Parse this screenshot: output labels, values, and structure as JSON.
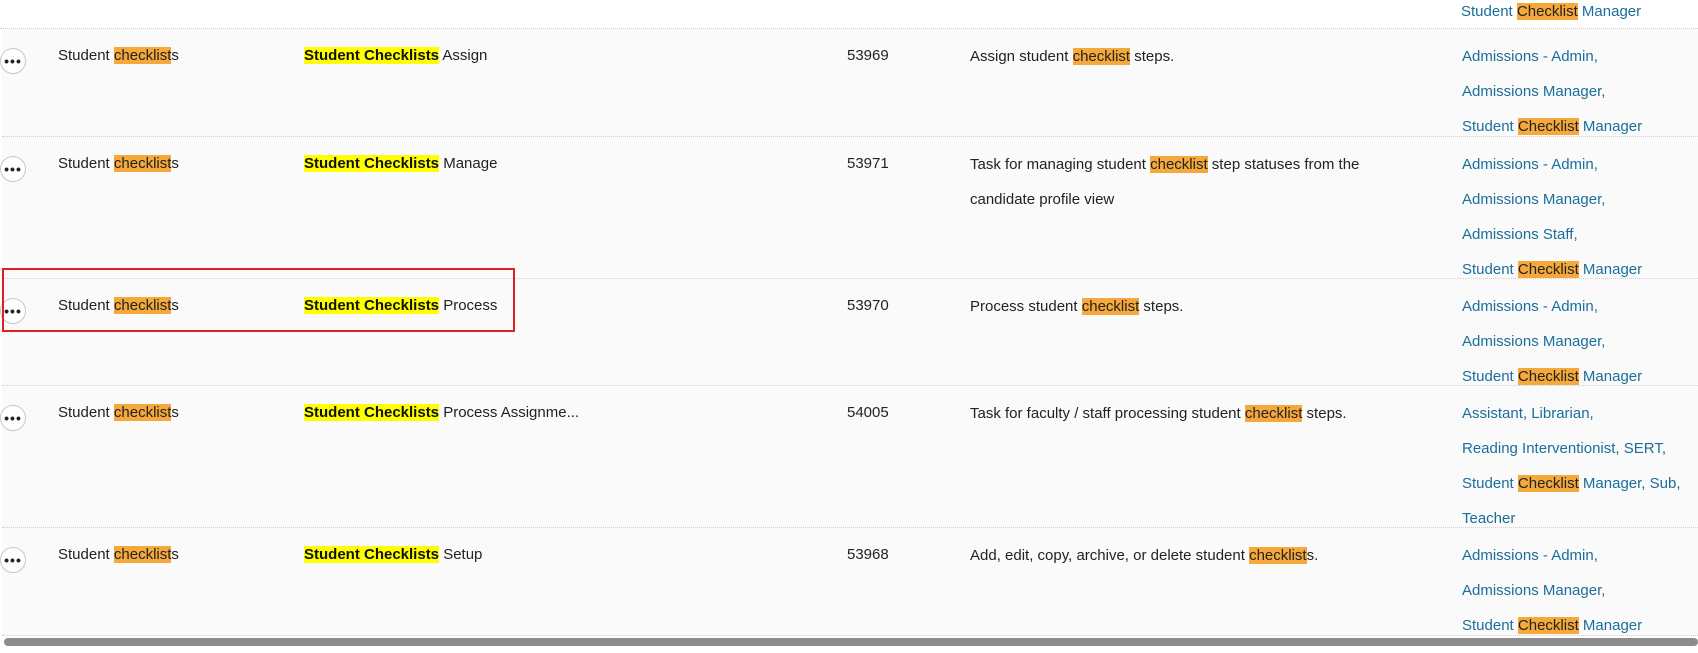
{
  "top_fragment": {
    "role_prefix": "Student ",
    "role_highlight": "Checklist",
    "role_suffix": " Manager"
  },
  "rows": [
    {
      "category": {
        "prefix": "Student ",
        "highlight": "checklist",
        "suffix": "s"
      },
      "task": {
        "highlight": "Student Checklists",
        "suffix": " Assign"
      },
      "id": "53969",
      "description": [
        {
          "t": "Assign student "
        },
        {
          "h": "checklist"
        },
        {
          "t": " steps."
        }
      ],
      "roles": [
        [
          {
            "t": "Admissions - Admin,"
          }
        ],
        [
          {
            "t": "Admissions Manager,"
          }
        ],
        [
          {
            "t": "Student "
          },
          {
            "h": "Checklist"
          },
          {
            "t": " Manager"
          }
        ]
      ]
    },
    {
      "category": {
        "prefix": "Student ",
        "highlight": "checklist",
        "suffix": "s"
      },
      "task": {
        "highlight": "Student Checklists",
        "suffix": " Manage"
      },
      "id": "53971",
      "description": [
        {
          "t": "Task for managing student "
        },
        {
          "h": "checklist"
        },
        {
          "t": " step statuses from the candidate profile view"
        }
      ],
      "roles": [
        [
          {
            "t": "Admissions - Admin,"
          }
        ],
        [
          {
            "t": "Admissions Manager,"
          }
        ],
        [
          {
            "t": "Admissions Staff,"
          }
        ],
        [
          {
            "t": "Student "
          },
          {
            "h": "Checklist"
          },
          {
            "t": " Manager"
          }
        ]
      ]
    },
    {
      "category": {
        "prefix": "Student ",
        "highlight": "checklist",
        "suffix": "s"
      },
      "task": {
        "highlight": "Student Checklists",
        "suffix": " Process"
      },
      "id": "53970",
      "description": [
        {
          "t": "Process student "
        },
        {
          "h": "checklist"
        },
        {
          "t": " steps."
        }
      ],
      "roles": [
        [
          {
            "t": "Admissions - Admin,"
          }
        ],
        [
          {
            "t": "Admissions Manager,"
          }
        ],
        [
          {
            "t": "Student "
          },
          {
            "h": "Checklist"
          },
          {
            "t": " Manager"
          }
        ]
      ]
    },
    {
      "category": {
        "prefix": "Student ",
        "highlight": "checklist",
        "suffix": "s"
      },
      "task": {
        "highlight": "Student Checklists",
        "suffix": " Process Assignme..."
      },
      "id": "54005",
      "description": [
        {
          "t": "Task for faculty / staff processing student "
        },
        {
          "h": "checklist"
        },
        {
          "t": " steps."
        }
      ],
      "roles": [
        [
          {
            "t": "Assistant, Librarian,"
          }
        ],
        [
          {
            "t": "Reading Interventionist, SERT,"
          }
        ],
        [
          {
            "t": "Student "
          },
          {
            "h": "Checklist"
          },
          {
            "t": " Manager, Sub,"
          }
        ],
        [
          {
            "t": "Teacher"
          }
        ]
      ]
    },
    {
      "category": {
        "prefix": "Student ",
        "highlight": "checklist",
        "suffix": "s"
      },
      "task": {
        "highlight": "Student Checklists",
        "suffix": " Setup"
      },
      "id": "53968",
      "description": [
        {
          "t": "Add, edit, copy, archive, or delete student "
        },
        {
          "h": "checklist"
        },
        {
          "t": "s."
        }
      ],
      "roles": [
        [
          {
            "t": "Admissions - Admin,"
          }
        ],
        [
          {
            "t": "Admissions Manager,"
          }
        ],
        [
          {
            "t": "Student "
          },
          {
            "h": "Checklist"
          },
          {
            "t": " Manager"
          }
        ]
      ]
    }
  ],
  "menu_glyph": "•••",
  "colors": {
    "link": "#1a6e9a",
    "highlight_yellow": "#ffff00",
    "highlight_orange": "#f5a93b",
    "selection_border": "#e02020"
  }
}
